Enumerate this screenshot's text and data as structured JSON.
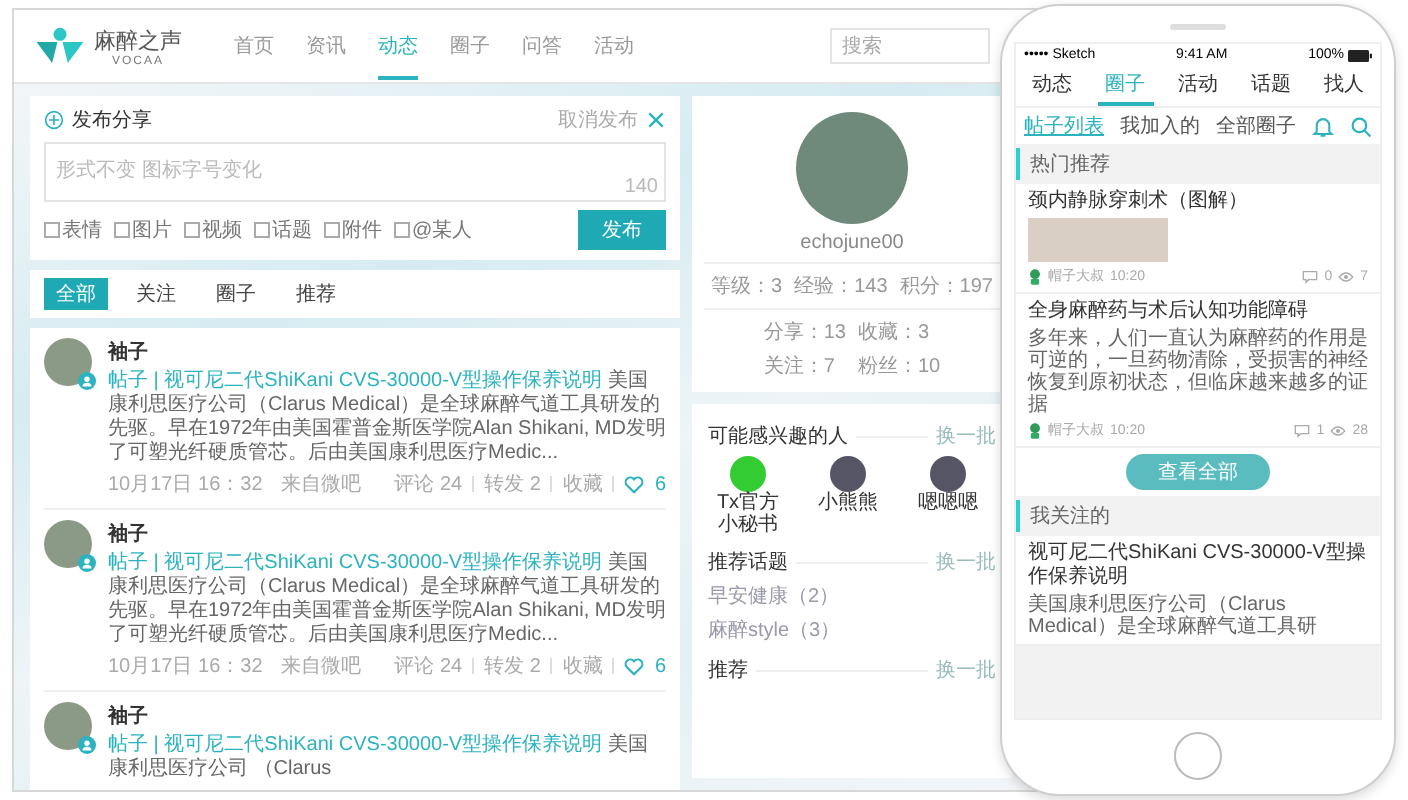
{
  "header": {
    "logo": {
      "name": "麻醉之声",
      "sub": "VOCAA"
    },
    "nav": [
      {
        "label": "首页",
        "selected": false
      },
      {
        "label": "资讯",
        "selected": false
      },
      {
        "label": "动态",
        "selected": true
      },
      {
        "label": "圈子",
        "selected": false
      },
      {
        "label": "问答",
        "selected": false
      },
      {
        "label": "活动",
        "selected": false
      }
    ],
    "search": {
      "placeholder": "搜索"
    }
  },
  "composer": {
    "title": "发布分享",
    "cancel": "取消发布",
    "placeholder": "形式不变 图标字号变化",
    "counter": "140",
    "tools": [
      "表情",
      "图片",
      "视频",
      "话题",
      "附件",
      "@某人"
    ],
    "submit": "发布"
  },
  "feed_tabs": [
    {
      "label": "全部",
      "selected": true
    },
    {
      "label": "关注",
      "selected": false
    },
    {
      "label": "圈子",
      "selected": false
    },
    {
      "label": "推荐",
      "selected": false
    }
  ],
  "posts": [
    {
      "name": "袖子",
      "link": "帖子 | 视可尼二代ShiKani CVS-30000-V型操作保养说明",
      "body": "美国康利思医疗公司（Clarus Medical）是全球麻醉气道工具研发的先驱。早在1972年由美国霍普金斯医学院Alan Shikani, MD发明了可塑光纤硬质管芯。后由美国康利思医疗Medic...",
      "time": "10月17日 16：32",
      "source": "来自微吧",
      "comments": "评论 24",
      "shares": "转发 2",
      "fav": "收藏",
      "likes": "6"
    },
    {
      "name": "袖子",
      "link": "帖子 | 视可尼二代ShiKani CVS-30000-V型操作保养说明",
      "body": "美国康利思医疗公司（Clarus Medical）是全球麻醉气道工具研发的先驱。早在1972年由美国霍普金斯医学院Alan Shikani, MD发明了可塑光纤硬质管芯。后由美国康利思医疗Medic...",
      "time": "10月17日 16：32",
      "source": "来自微吧",
      "comments": "评论 24",
      "shares": "转发 2",
      "fav": "收藏",
      "likes": "6"
    },
    {
      "name": "袖子",
      "link": "帖子 | 视可尼二代ShiKani CVS-30000-V型操作保养说明",
      "body": "美国康利思医疗公司 （Clarus"
    }
  ],
  "profile": {
    "username": "echojune00",
    "stats": [
      "等级：3",
      "经验：143",
      "积分：197"
    ],
    "counts": [
      "分享：13",
      "收藏：3",
      "关注：7",
      "粉丝：10"
    ]
  },
  "people": {
    "title": "可能感兴趣的人",
    "more": "换一批",
    "items": [
      "Tx官方小秘书",
      "小熊熊",
      "嗯嗯嗯"
    ]
  },
  "topics": {
    "title": "推荐话题",
    "more": "换一批",
    "items": [
      "早安健康（2）",
      "麻醉style（3）"
    ]
  },
  "recommend": {
    "title": "推荐",
    "more": "换一批"
  },
  "phone": {
    "carrier": "••••• Sketch",
    "time": "9:41 AM",
    "battery": "100%",
    "tabs": [
      {
        "label": "动态",
        "selected": false
      },
      {
        "label": "圈子",
        "selected": true
      },
      {
        "label": "活动",
        "selected": false
      },
      {
        "label": "话题",
        "selected": false
      },
      {
        "label": "找人",
        "selected": false
      }
    ],
    "subtabs": [
      {
        "label": "帖子列表",
        "selected": true
      },
      {
        "label": "我加入的",
        "selected": false
      },
      {
        "label": "全部圈子",
        "selected": false
      }
    ],
    "hot_label": "热门推荐",
    "hot_posts": [
      {
        "title": "颈内静脉穿刺术（图解）",
        "image": true,
        "author": "帽子大叔",
        "time": "10:20",
        "comments": "0",
        "views": "7"
      },
      {
        "title": "全身麻醉药与术后认知功能障碍",
        "body": "多年来，人们一直认为麻醉药的作用是可逆的，一旦药物清除，受损害的神经恢复到原初状态，但临床越来越多的证据",
        "image": false,
        "author": "帽子大叔",
        "time": "10:20",
        "comments": "1",
        "views": "28"
      }
    ],
    "view_all": "查看全部",
    "follow_label": "我关注的",
    "follow_title": "视可尼二代ShiKani CVS-30000-V型操作保养说明",
    "follow_body": "美国康利思医疗公司（Clarus Medical）是全球麻醉气道工具研"
  }
}
